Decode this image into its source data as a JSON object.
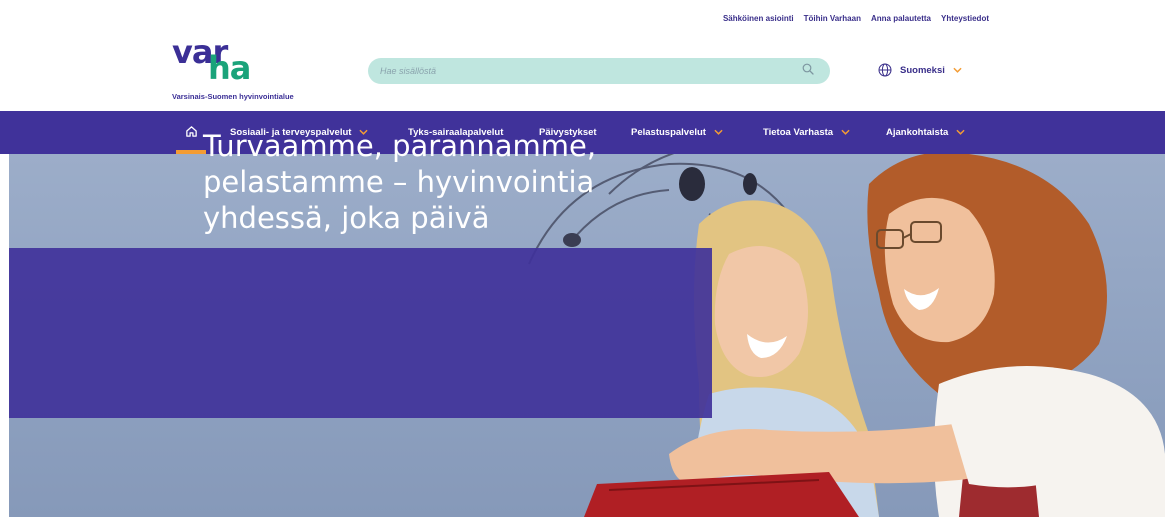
{
  "utility_nav": {
    "items": [
      "Sähköinen asiointi",
      "Töihin Varhaan",
      "Anna palautetta",
      "Yhteystiedot"
    ]
  },
  "logo": {
    "word_part1": "var",
    "word_part2": "ha",
    "subtitle": "Varsinais-Suomen hyvinvointialue",
    "colors": {
      "var": "#3b2f96",
      "ha": "#1aa37a"
    }
  },
  "search": {
    "placeholder": "Hae sisällöstä",
    "icon": "search-icon"
  },
  "language": {
    "selected": "Suomeksi",
    "icon": "globe-icon"
  },
  "main_nav": {
    "home_icon": "home-icon",
    "items": [
      {
        "label": "Sosiaali- ja terveyspalvelut",
        "has_dropdown": true
      },
      {
        "label": "Tyks-sairaalapalvelut",
        "has_dropdown": false
      },
      {
        "label": "Päivystykset",
        "has_dropdown": false
      },
      {
        "label": "Pelastuspalvelut",
        "has_dropdown": true
      },
      {
        "label": "Tietoa Varhasta",
        "has_dropdown": true
      },
      {
        "label": "Ajankohtaista",
        "has_dropdown": true
      }
    ]
  },
  "hero": {
    "title": "Turvaamme, parannamme, pelastamme – hyvinvointia yhdessä, joka päivä"
  },
  "colors": {
    "brand_purple": "#40329a",
    "accent_orange": "#f39c34",
    "search_bg": "#bfe6df"
  }
}
